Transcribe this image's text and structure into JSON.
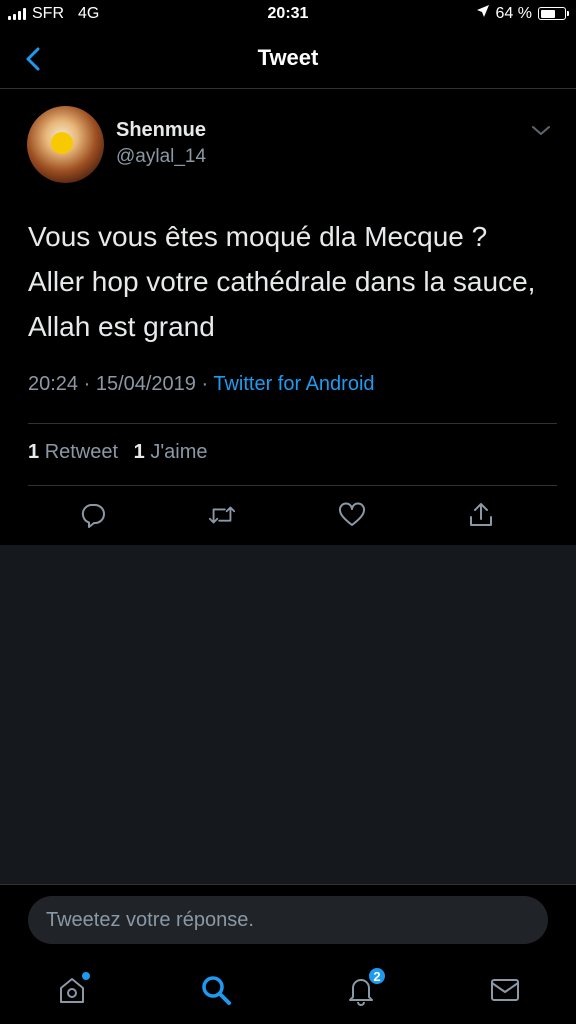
{
  "status_bar": {
    "carrier": "SFR",
    "network": "4G",
    "time": "20:31",
    "battery": "64 %",
    "battery_level": 0.64
  },
  "header": {
    "title": "Tweet"
  },
  "tweet": {
    "author_name": "Shenmue",
    "author_handle": "@aylal_14",
    "text": "Vous vous êtes moqué dla Mecque ? Aller hop votre cathédrale dans la sauce, Allah est grand",
    "timestamp": "20:24 · 15/04/2019 ·",
    "source": "Twitter for Android",
    "retweet_count": "1",
    "retweet_label": "Retweet",
    "like_count": "1",
    "like_label": "J'aime"
  },
  "reply": {
    "placeholder": "Tweetez votre réponse."
  },
  "tab_bar": {
    "notifications_badge": "2"
  },
  "colors": {
    "accent": "#1d9bf0",
    "background": "#000000",
    "secondary_text": "#8b98a5"
  },
  "icons": [
    "back-chevron",
    "chevron-down",
    "reply",
    "retweet",
    "like",
    "share",
    "home",
    "search",
    "notifications",
    "messages"
  ]
}
